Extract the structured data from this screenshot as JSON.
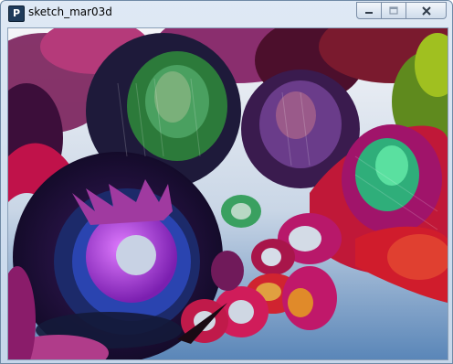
{
  "window": {
    "title": "sketch_mar03d",
    "app_icon_glyph": "P",
    "controls": {
      "minimize": "minimize-icon",
      "maximize": "maximize-icon",
      "close": "close-icon"
    }
  },
  "sketch": {
    "background_top": "#f4f5f8",
    "background_bottom": "#5a86b8"
  }
}
